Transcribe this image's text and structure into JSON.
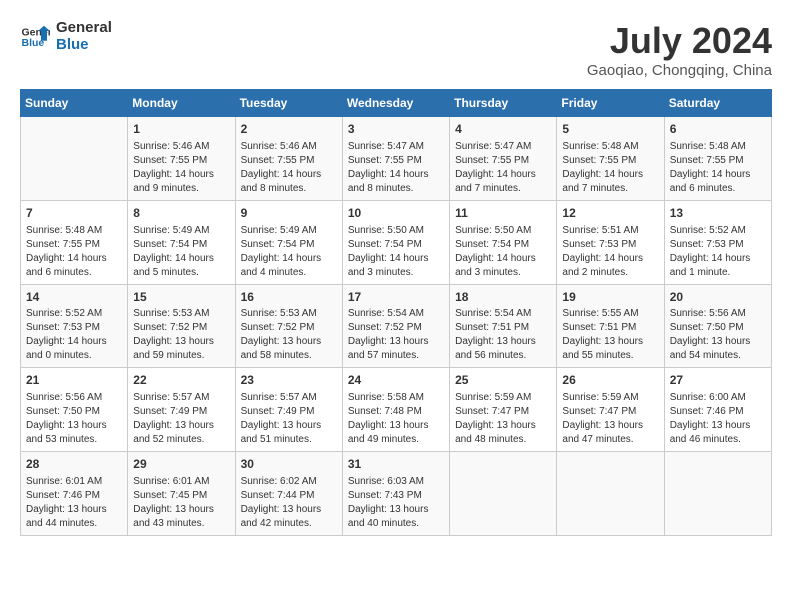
{
  "header": {
    "logo_line1": "General",
    "logo_line2": "Blue",
    "month": "July 2024",
    "location": "Gaoqiao, Chongqing, China"
  },
  "weekdays": [
    "Sunday",
    "Monday",
    "Tuesday",
    "Wednesday",
    "Thursday",
    "Friday",
    "Saturday"
  ],
  "weeks": [
    [
      {
        "day": "",
        "empty": true
      },
      {
        "day": "1",
        "sunrise": "5:46 AM",
        "sunset": "7:55 PM",
        "daylight": "14 hours and 9 minutes."
      },
      {
        "day": "2",
        "sunrise": "5:46 AM",
        "sunset": "7:55 PM",
        "daylight": "14 hours and 8 minutes."
      },
      {
        "day": "3",
        "sunrise": "5:47 AM",
        "sunset": "7:55 PM",
        "daylight": "14 hours and 8 minutes."
      },
      {
        "day": "4",
        "sunrise": "5:47 AM",
        "sunset": "7:55 PM",
        "daylight": "14 hours and 7 minutes."
      },
      {
        "day": "5",
        "sunrise": "5:48 AM",
        "sunset": "7:55 PM",
        "daylight": "14 hours and 7 minutes."
      },
      {
        "day": "6",
        "sunrise": "5:48 AM",
        "sunset": "7:55 PM",
        "daylight": "14 hours and 6 minutes."
      }
    ],
    [
      {
        "day": "7",
        "sunrise": "5:48 AM",
        "sunset": "7:55 PM",
        "daylight": "14 hours and 6 minutes."
      },
      {
        "day": "8",
        "sunrise": "5:49 AM",
        "sunset": "7:54 PM",
        "daylight": "14 hours and 5 minutes."
      },
      {
        "day": "9",
        "sunrise": "5:49 AM",
        "sunset": "7:54 PM",
        "daylight": "14 hours and 4 minutes."
      },
      {
        "day": "10",
        "sunrise": "5:50 AM",
        "sunset": "7:54 PM",
        "daylight": "14 hours and 3 minutes."
      },
      {
        "day": "11",
        "sunrise": "5:50 AM",
        "sunset": "7:54 PM",
        "daylight": "14 hours and 3 minutes."
      },
      {
        "day": "12",
        "sunrise": "5:51 AM",
        "sunset": "7:53 PM",
        "daylight": "14 hours and 2 minutes."
      },
      {
        "day": "13",
        "sunrise": "5:52 AM",
        "sunset": "7:53 PM",
        "daylight": "14 hours and 1 minute."
      }
    ],
    [
      {
        "day": "14",
        "sunrise": "5:52 AM",
        "sunset": "7:53 PM",
        "daylight": "14 hours and 0 minutes."
      },
      {
        "day": "15",
        "sunrise": "5:53 AM",
        "sunset": "7:52 PM",
        "daylight": "13 hours and 59 minutes."
      },
      {
        "day": "16",
        "sunrise": "5:53 AM",
        "sunset": "7:52 PM",
        "daylight": "13 hours and 58 minutes."
      },
      {
        "day": "17",
        "sunrise": "5:54 AM",
        "sunset": "7:52 PM",
        "daylight": "13 hours and 57 minutes."
      },
      {
        "day": "18",
        "sunrise": "5:54 AM",
        "sunset": "7:51 PM",
        "daylight": "13 hours and 56 minutes."
      },
      {
        "day": "19",
        "sunrise": "5:55 AM",
        "sunset": "7:51 PM",
        "daylight": "13 hours and 55 minutes."
      },
      {
        "day": "20",
        "sunrise": "5:56 AM",
        "sunset": "7:50 PM",
        "daylight": "13 hours and 54 minutes."
      }
    ],
    [
      {
        "day": "21",
        "sunrise": "5:56 AM",
        "sunset": "7:50 PM",
        "daylight": "13 hours and 53 minutes."
      },
      {
        "day": "22",
        "sunrise": "5:57 AM",
        "sunset": "7:49 PM",
        "daylight": "13 hours and 52 minutes."
      },
      {
        "day": "23",
        "sunrise": "5:57 AM",
        "sunset": "7:49 PM",
        "daylight": "13 hours and 51 minutes."
      },
      {
        "day": "24",
        "sunrise": "5:58 AM",
        "sunset": "7:48 PM",
        "daylight": "13 hours and 49 minutes."
      },
      {
        "day": "25",
        "sunrise": "5:59 AM",
        "sunset": "7:47 PM",
        "daylight": "13 hours and 48 minutes."
      },
      {
        "day": "26",
        "sunrise": "5:59 AM",
        "sunset": "7:47 PM",
        "daylight": "13 hours and 47 minutes."
      },
      {
        "day": "27",
        "sunrise": "6:00 AM",
        "sunset": "7:46 PM",
        "daylight": "13 hours and 46 minutes."
      }
    ],
    [
      {
        "day": "28",
        "sunrise": "6:01 AM",
        "sunset": "7:46 PM",
        "daylight": "13 hours and 44 minutes."
      },
      {
        "day": "29",
        "sunrise": "6:01 AM",
        "sunset": "7:45 PM",
        "daylight": "13 hours and 43 minutes."
      },
      {
        "day": "30",
        "sunrise": "6:02 AM",
        "sunset": "7:44 PM",
        "daylight": "13 hours and 42 minutes."
      },
      {
        "day": "31",
        "sunrise": "6:03 AM",
        "sunset": "7:43 PM",
        "daylight": "13 hours and 40 minutes."
      },
      {
        "day": "",
        "empty": true
      },
      {
        "day": "",
        "empty": true
      },
      {
        "day": "",
        "empty": true
      }
    ]
  ],
  "labels": {
    "sunrise": "Sunrise:",
    "sunset": "Sunset:",
    "daylight": "Daylight:"
  }
}
